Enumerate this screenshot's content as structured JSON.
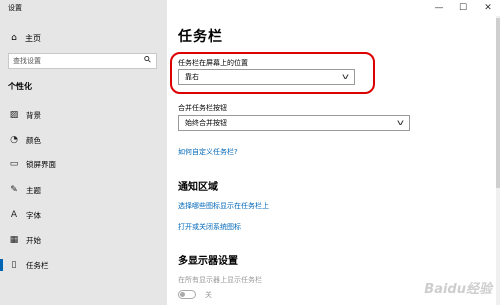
{
  "window": {
    "title": "设置",
    "minimize_glyph": "—",
    "maximize_glyph": "☐",
    "close_glyph": "✕"
  },
  "sidebar": {
    "home": {
      "label": "主页",
      "icon": "home-icon"
    },
    "search": {
      "placeholder": "查找设置"
    },
    "section_label": "个性化",
    "items": [
      {
        "label": "背景",
        "icon": "picture-icon"
      },
      {
        "label": "颜色",
        "icon": "palette-icon"
      },
      {
        "label": "锁屏界面",
        "icon": "monitor-icon"
      },
      {
        "label": "主题",
        "icon": "theme-icon"
      },
      {
        "label": "字体",
        "icon": "font-icon"
      },
      {
        "label": "开始",
        "icon": "start-icon"
      },
      {
        "label": "任务栏",
        "icon": "taskbar-icon",
        "selected": true
      }
    ]
  },
  "main": {
    "title": "任务栏",
    "position": {
      "label": "任务栏在屏幕上的位置",
      "value": "靠右"
    },
    "combine": {
      "label": "合并任务栏按钮",
      "value": "始终合并按钮"
    },
    "customize_link": "如何自定义任务栏?",
    "notification": {
      "title": "通知区域",
      "link1": "选择哪些图标显示在任务栏上",
      "link2": "打开或关闭系统图标"
    },
    "multi_display": {
      "title": "多显示器设置",
      "show_label": "在所有显示器上显示任务栏",
      "toggle_state": "关"
    }
  },
  "colors": {
    "accent": "#0067b8",
    "highlight_border": "#dd0000",
    "sidebar_bg": "#e6e6e6"
  },
  "watermark": "Baidu经验"
}
